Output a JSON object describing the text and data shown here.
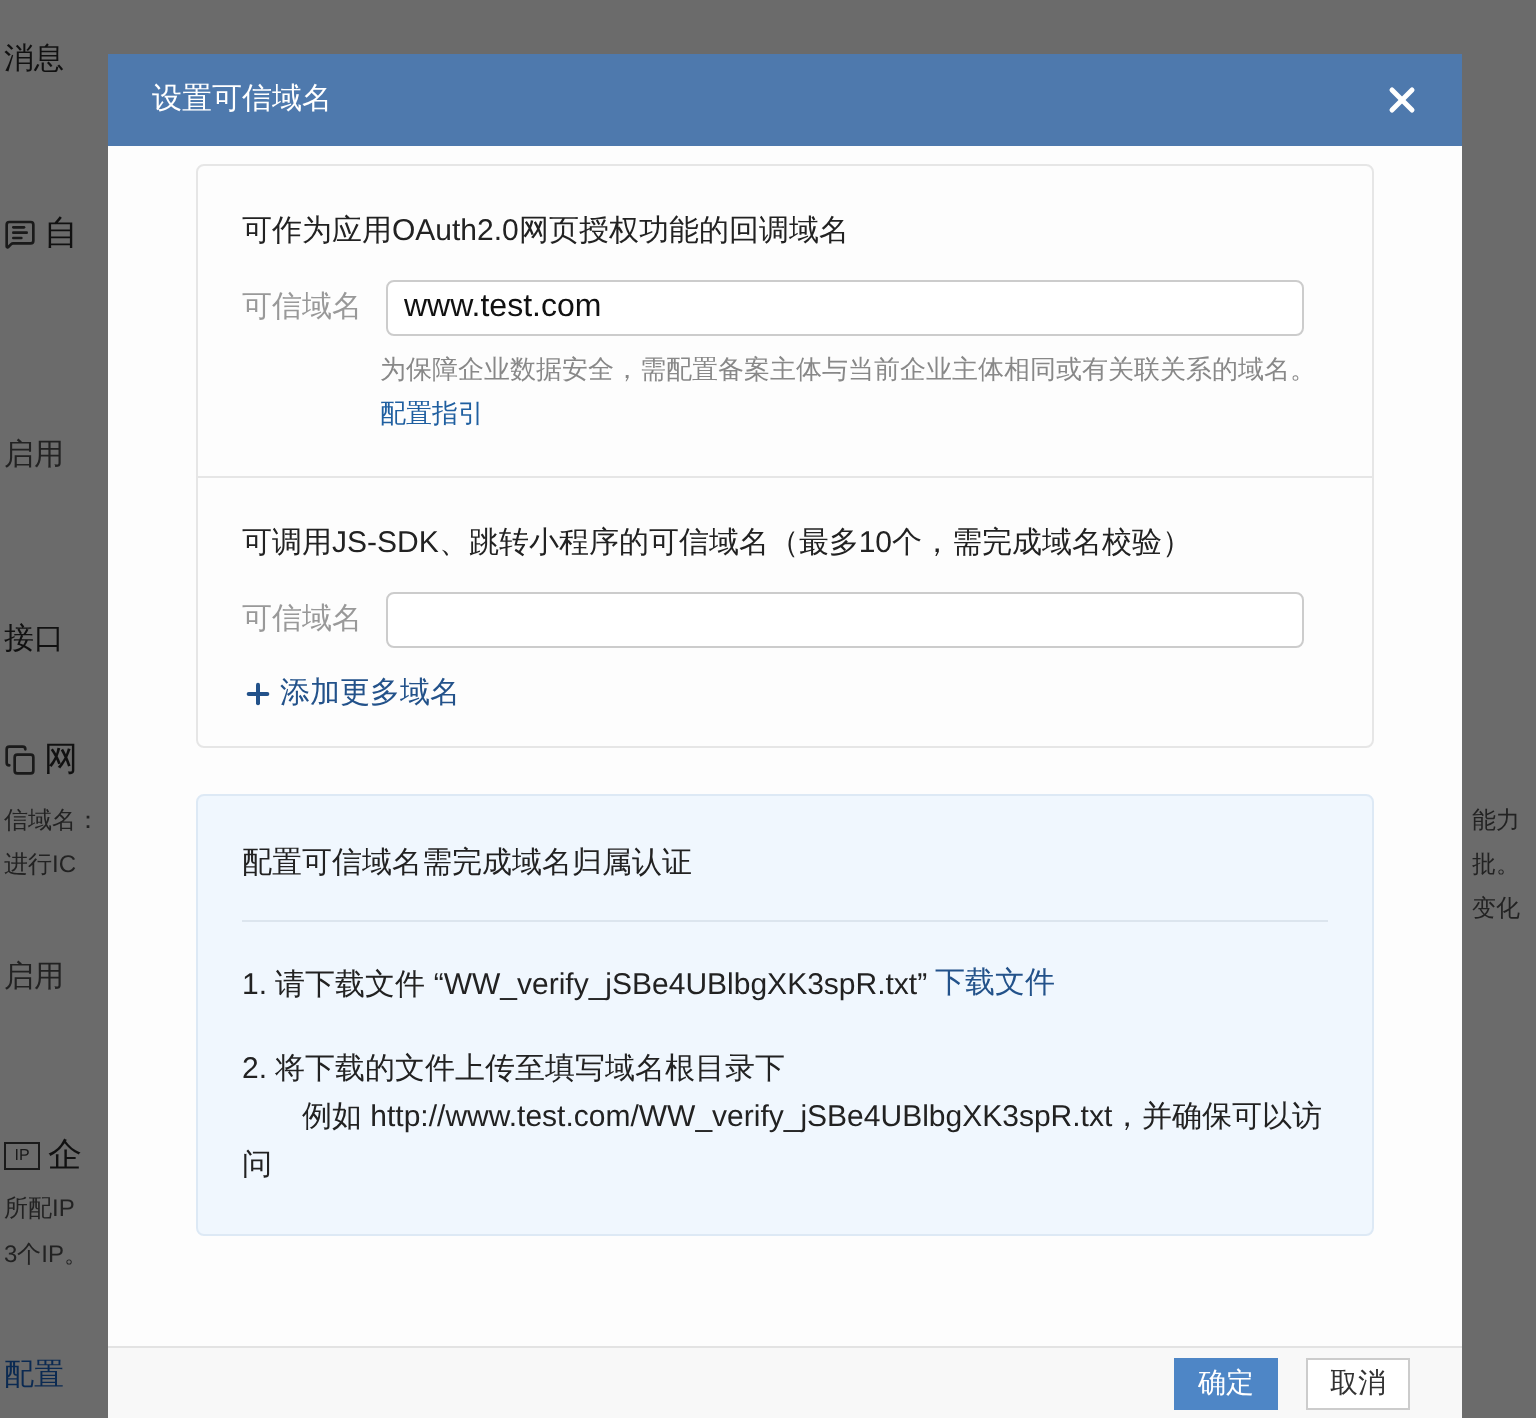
{
  "background": {
    "left": [
      {
        "kind": "text",
        "text": "消息"
      },
      {
        "kind": "chat_heading",
        "text": "自"
      },
      {
        "kind": "status",
        "text": "启用"
      },
      {
        "kind": "text",
        "text": "接口"
      },
      {
        "kind": "page_heading",
        "text": "网"
      },
      {
        "kind": "small",
        "text": "信域名："
      },
      {
        "kind": "small",
        "text": "进行IC"
      },
      {
        "kind": "status",
        "text": "启用"
      },
      {
        "kind": "ip_heading",
        "badge": "IP",
        "text": "企"
      },
      {
        "kind": "small",
        "text": "所配IP"
      },
      {
        "kind": "small",
        "text": "3个IP。"
      },
      {
        "kind": "link",
        "text": "配置"
      }
    ],
    "right": [
      "能力",
      "批。",
      "变化"
    ]
  },
  "dialog": {
    "title": "设置可信域名",
    "sections": [
      {
        "title": "可作为应用OAuth2.0网页授权功能的回调域名",
        "field_label": "可信域名",
        "value": "www.test.com",
        "hint": "为保障企业数据安全，需配置备案主体与当前企业主体相同或有关联关系的域名。",
        "hint_link": "配置指引"
      },
      {
        "title": "可调用JS-SDK、跳转小程序的可信域名（最多10个，需完成域名校验）",
        "field_label": "可信域名",
        "add_link": "添加更多域名"
      }
    ],
    "verification": {
      "title": "配置可信域名需完成域名归属认证",
      "steps": [
        {
          "text": "1. 请下载文件 “WW_verify_jSBe4UBlbgXK3spR.txt”",
          "link": "下载文件"
        },
        {
          "text": "2. 将下载的文件上传至填写域名根目录下",
          "detail": "例如 http://www.test.com/WW_verify_jSBe4UBlbgXK3spR.txt，并确保可以访问"
        }
      ]
    },
    "buttons": [
      {
        "label": "确定",
        "kind": "primary"
      },
      {
        "label": "取消",
        "kind": "default"
      }
    ]
  }
}
